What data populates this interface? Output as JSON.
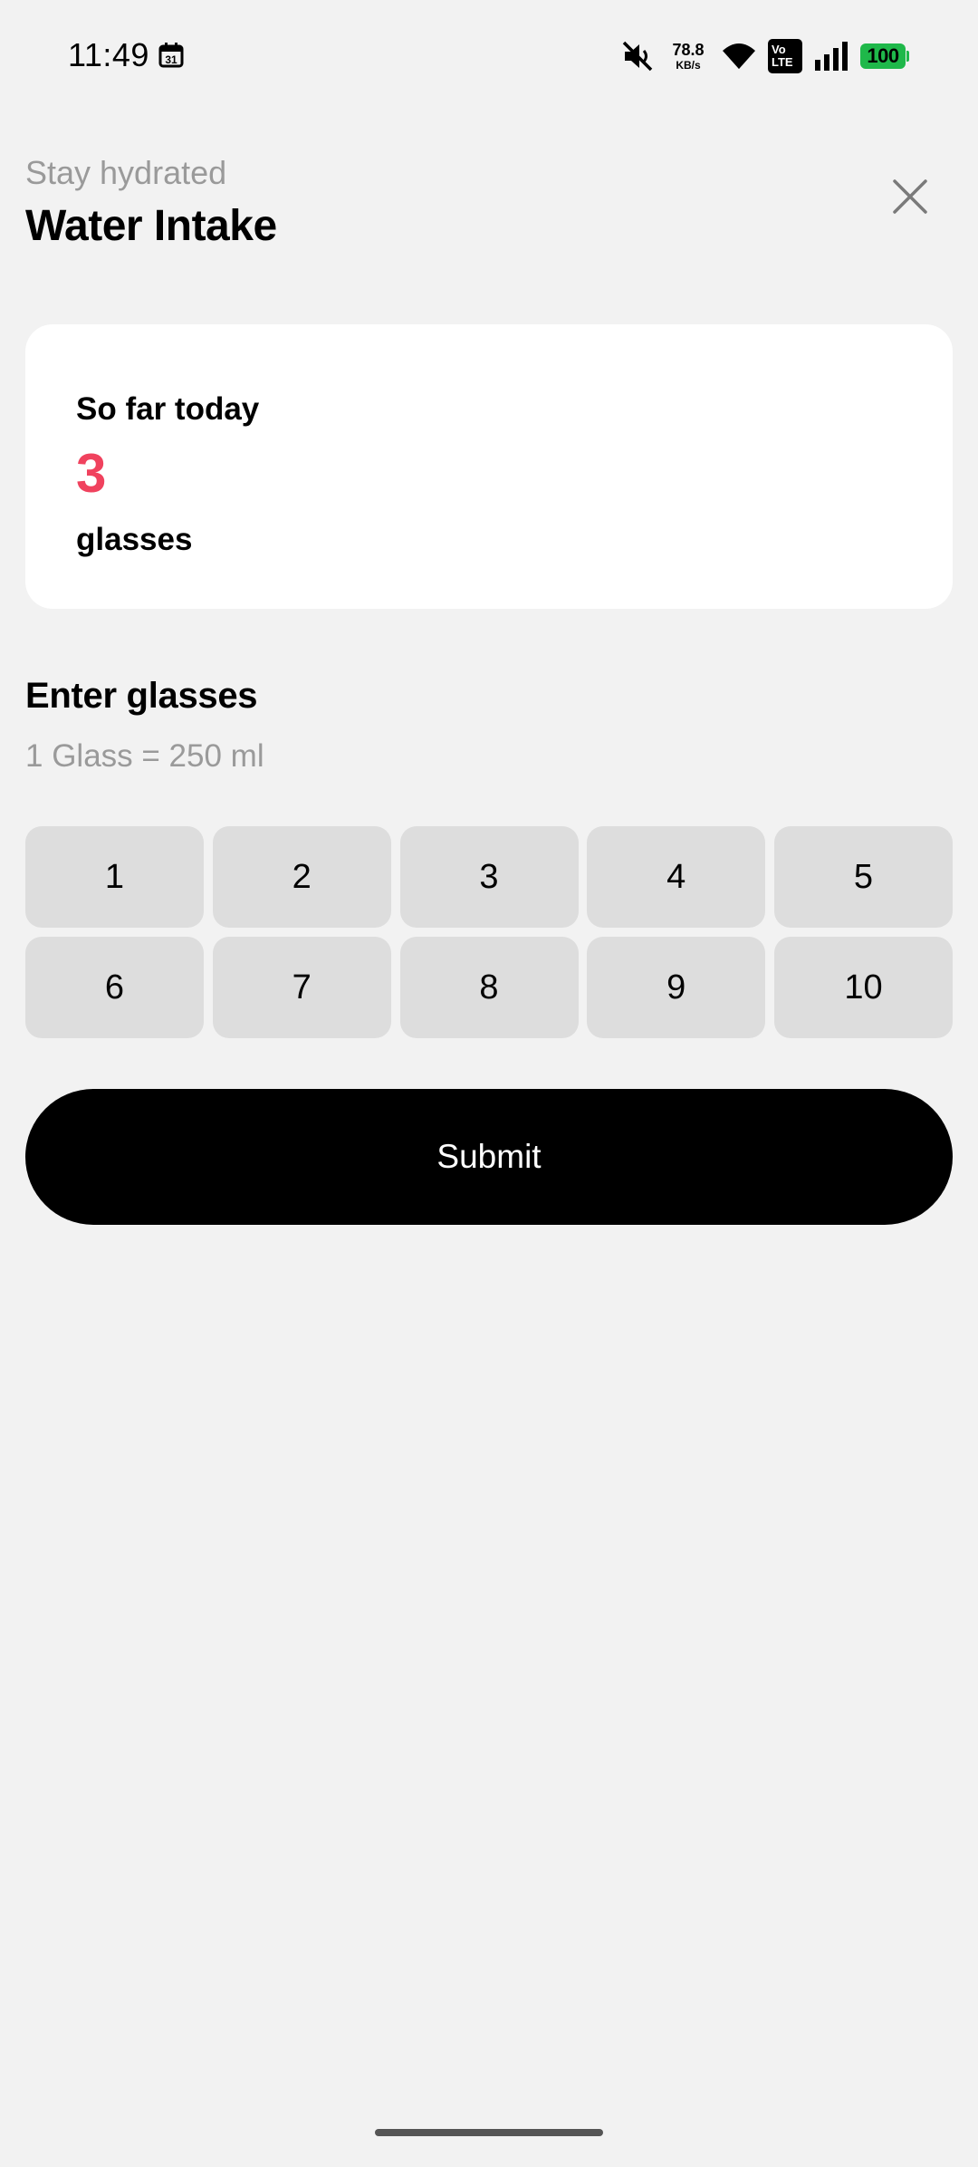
{
  "status_bar": {
    "time": "11:49",
    "calendar_day": "31",
    "net_speed_value": "78.8",
    "net_speed_unit": "KB/s",
    "volte_top": "Vo",
    "volte_bottom": "LTE",
    "battery": "100",
    "battery_color": "#1fb84a"
  },
  "header": {
    "subtitle": "Stay hydrated",
    "title": "Water Intake"
  },
  "summary": {
    "label": "So far today",
    "value": "3",
    "unit": "glasses",
    "value_color": "#f0425e"
  },
  "entry": {
    "title": "Enter glasses",
    "hint": "1 Glass = 250 ml",
    "options": [
      "1",
      "2",
      "3",
      "4",
      "5",
      "6",
      "7",
      "8",
      "9",
      "10"
    ]
  },
  "submit_label": "Submit"
}
